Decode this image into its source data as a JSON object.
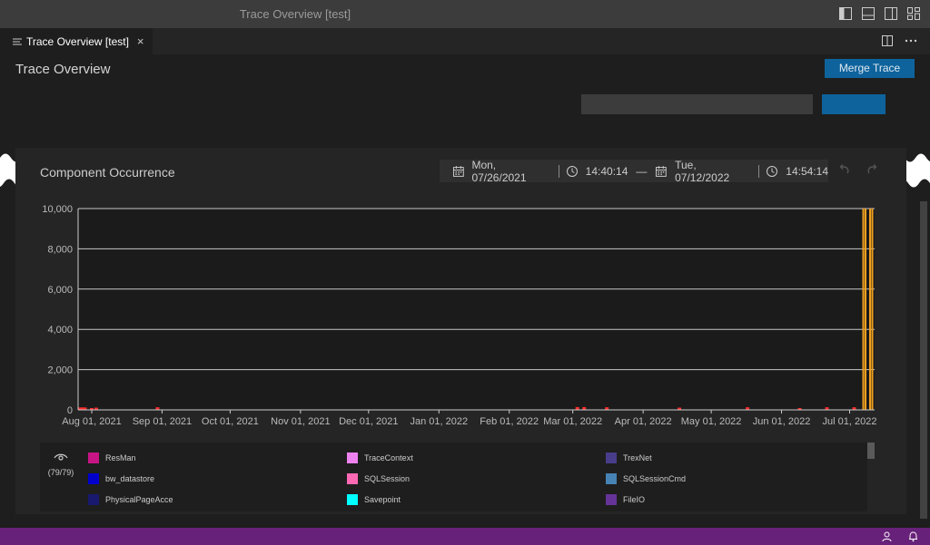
{
  "window": {
    "title": "Trace Overview [test]"
  },
  "tab": {
    "label": "Trace Overview [test]",
    "close": "×"
  },
  "page": {
    "title": "Trace Overview",
    "merge_button": "Merge Trace"
  },
  "panel": {
    "title": "Component Occurrence",
    "start_date": "Mon, 07/26/2021",
    "start_time": "14:40:14",
    "end_date": "Tue, 07/12/2022",
    "end_time": "14:54:14"
  },
  "legend": {
    "visible_count": "(79/79)",
    "items": [
      {
        "name": "ResMan",
        "color": "#c71585"
      },
      {
        "name": "TraceContext",
        "color": "#ee82ee"
      },
      {
        "name": "TrexNet",
        "color": "#483d8b"
      },
      {
        "name": "bw_datastore",
        "color": "#0000cd"
      },
      {
        "name": "SQLSession",
        "color": "#ff69b4"
      },
      {
        "name": "SQLSessionCmd",
        "color": "#4682b4"
      },
      {
        "name": "PhysicalPageAcce",
        "color": "#191970"
      },
      {
        "name": "Savepoint",
        "color": "#00ffff"
      },
      {
        "name": "FileIO",
        "color": "#663399"
      }
    ]
  },
  "chart_data": {
    "type": "bar",
    "ylim": [
      0,
      10000
    ],
    "yticks": [
      "0",
      "2,000",
      "4,000",
      "6,000",
      "8,000",
      "10,000"
    ],
    "xticks": [
      "Aug 01, 2021",
      "Sep 01, 2021",
      "Oct 01, 2021",
      "Nov 01, 2021",
      "Dec 01, 2021",
      "Jan 01, 2022",
      "Feb 01, 2022",
      "Mar 01, 2022",
      "Apr 01, 2022",
      "May 01, 2022",
      "Jun 01, 2022",
      "Jul 01, 2022"
    ],
    "series": [
      {
        "color": "#ff2d2d",
        "points": [
          {
            "x": "2021-07-27",
            "y": 120
          },
          {
            "x": "2021-07-28",
            "y": 120
          },
          {
            "x": "2021-07-29",
            "y": 120
          },
          {
            "x": "2021-08-01",
            "y": 80
          },
          {
            "x": "2021-08-03",
            "y": 110
          },
          {
            "x": "2021-08-30",
            "y": 130
          },
          {
            "x": "2022-03-03",
            "y": 140
          },
          {
            "x": "2022-03-06",
            "y": 140
          },
          {
            "x": "2022-03-16",
            "y": 130
          },
          {
            "x": "2022-04-17",
            "y": 110
          },
          {
            "x": "2022-05-17",
            "y": 130
          },
          {
            "x": "2022-06-09",
            "y": 80
          },
          {
            "x": "2022-06-21",
            "y": 130
          },
          {
            "x": "2022-07-03",
            "y": 130
          }
        ]
      },
      {
        "color": "#f0a020",
        "points": [
          {
            "x": "2022-07-07",
            "y": 10000
          },
          {
            "x": "2022-07-08",
            "y": 10000
          },
          {
            "x": "2022-07-10",
            "y": 10000
          },
          {
            "x": "2022-07-11",
            "y": 10000
          }
        ]
      }
    ]
  }
}
